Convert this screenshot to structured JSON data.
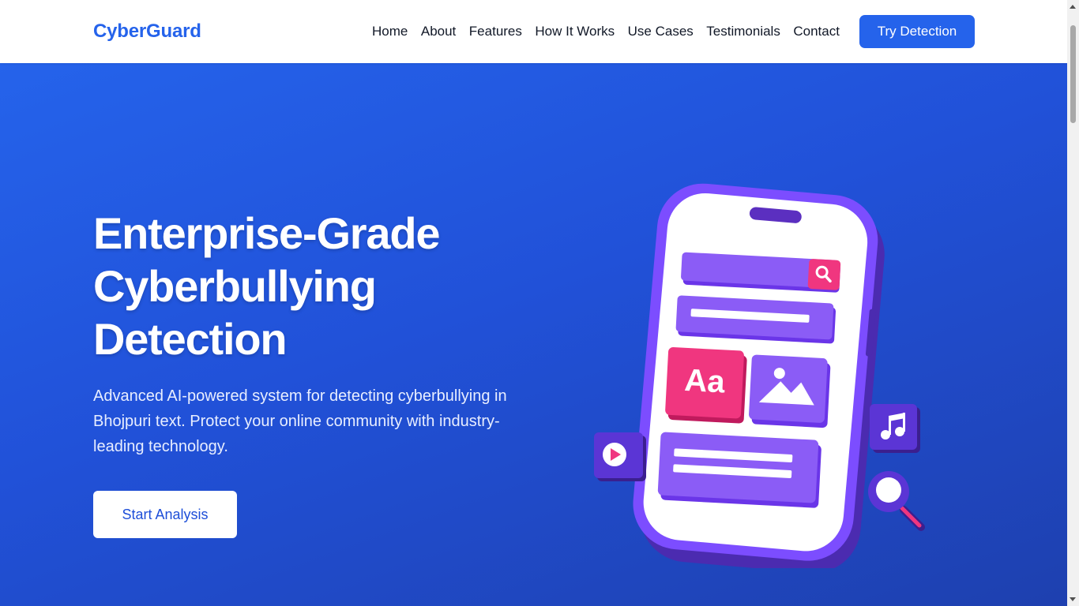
{
  "brand": {
    "name": "CyberGuard",
    "color": "#2563eb"
  },
  "nav": {
    "items": [
      {
        "label": "Home"
      },
      {
        "label": "About"
      },
      {
        "label": "Features"
      },
      {
        "label": "How It Works"
      },
      {
        "label": "Use Cases"
      },
      {
        "label": "Testimonials"
      },
      {
        "label": "Contact"
      }
    ],
    "cta_label": "Try Detection"
  },
  "hero": {
    "title": "Enterprise-Grade Cyberbullying Detection",
    "subtitle": "Advanced AI-powered system for detecting cyberbullying in Bhojpuri text. Protect your online community with industry-leading technology.",
    "button_label": "Start Analysis",
    "illustration": {
      "text_tile": "Aa",
      "icons": [
        "search-icon",
        "play-icon",
        "music-note-icon",
        "magnifier-icon",
        "image-icon"
      ]
    }
  },
  "colors": {
    "hero_bg": "#2563eb",
    "phone_frame": "#7c4dff",
    "accent_pink": "#f0367f",
    "text_dark": "#111827"
  }
}
